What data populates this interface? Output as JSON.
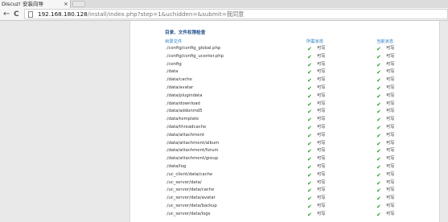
{
  "browser": {
    "tab_title": "Discuz! 安装向导",
    "close_glyph": "×",
    "back_glyph": "←",
    "reload_glyph": "C",
    "url_host": "192.168.180.128",
    "url_path": "/install/index.php?step=1&uchidden=&submit=我同意"
  },
  "page": {
    "section_title": "目录、文件权限检查",
    "columns": [
      "目录文件",
      "所需状态",
      "当前状态"
    ],
    "check_glyph": "✔",
    "rows": [
      {
        "path": "./config/config_global.php",
        "required": "可写",
        "current": "可写"
      },
      {
        "path": "./config/config_ucenter.php",
        "required": "可写",
        "current": "可写"
      },
      {
        "path": "./config",
        "required": "可写",
        "current": "可写"
      },
      {
        "path": "./data",
        "required": "可写",
        "current": "可写"
      },
      {
        "path": "./data/cache",
        "required": "可写",
        "current": "可写"
      },
      {
        "path": "./data/avatar",
        "required": "可写",
        "current": "可写"
      },
      {
        "path": "./data/plugindata",
        "required": "可写",
        "current": "可写"
      },
      {
        "path": "./data/download",
        "required": "可写",
        "current": "可写"
      },
      {
        "path": "./data/addonmd5",
        "required": "可写",
        "current": "可写"
      },
      {
        "path": "./data/template",
        "required": "可写",
        "current": "可写"
      },
      {
        "path": "./data/threadcache",
        "required": "可写",
        "current": "可写"
      },
      {
        "path": "./data/attachment",
        "required": "可写",
        "current": "可写"
      },
      {
        "path": "./data/attachment/album",
        "required": "可写",
        "current": "可写"
      },
      {
        "path": "./data/attachment/forum",
        "required": "可写",
        "current": "可写"
      },
      {
        "path": "./data/attachment/group",
        "required": "可写",
        "current": "可写"
      },
      {
        "path": "./data/log",
        "required": "可写",
        "current": "可写"
      },
      {
        "path": "./uc_client/data/cache",
        "required": "可写",
        "current": "可写"
      },
      {
        "path": "./uc_server/data/",
        "required": "可写",
        "current": "可写"
      },
      {
        "path": "./uc_server/data/cache",
        "required": "可写",
        "current": "可写"
      },
      {
        "path": "./uc_server/data/avatar",
        "required": "可写",
        "current": "可写"
      },
      {
        "path": "./uc_server/data/backup",
        "required": "可写",
        "current": "可写"
      },
      {
        "path": "./uc_server/data/logs",
        "required": "可写",
        "current": "可写"
      }
    ]
  }
}
